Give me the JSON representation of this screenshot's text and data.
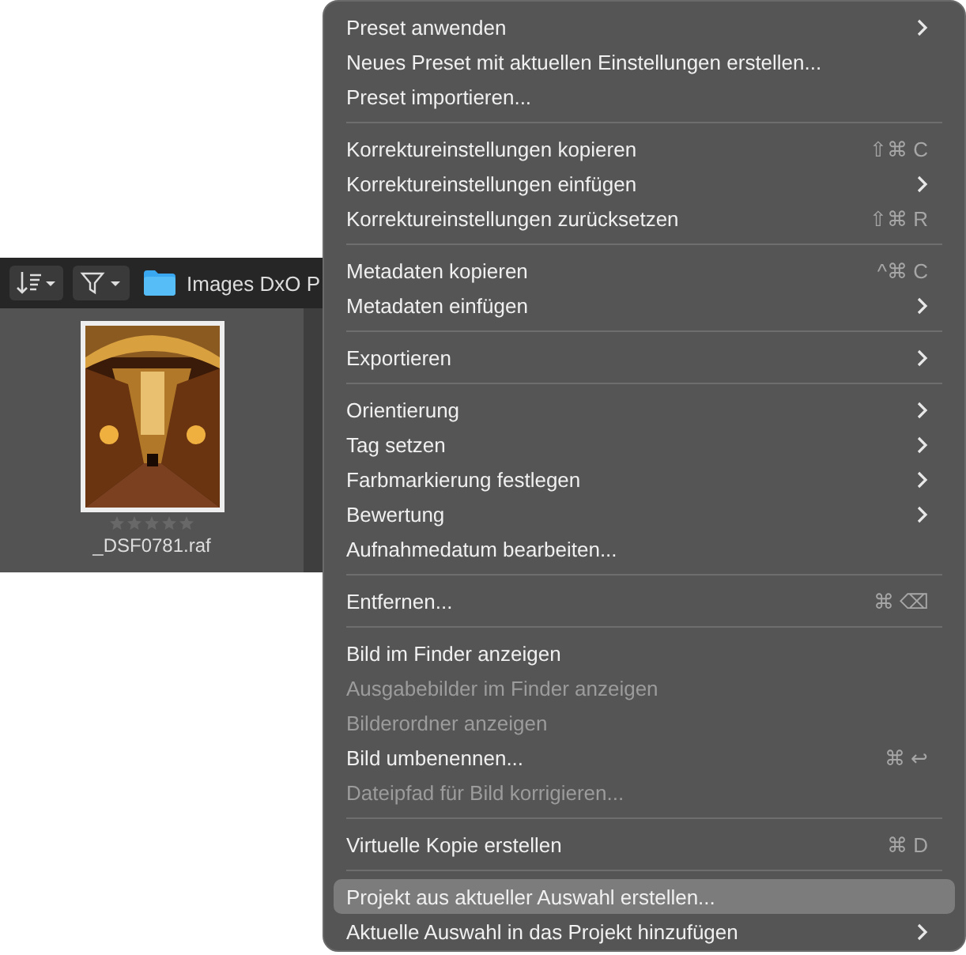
{
  "browser": {
    "folder": "Images DxO P",
    "thumbnail": {
      "kind": "picture",
      "stars": 0,
      "filename": "_DSF0781.raf"
    }
  },
  "menu": {
    "groups": [
      [
        {
          "label": "Preset anwenden",
          "submenu": true,
          "disabled": false,
          "selected": false
        },
        {
          "label": "Neues Preset mit aktuellen Einstellungen erstellen...",
          "submenu": false,
          "disabled": false,
          "selected": false
        },
        {
          "label": "Preset importieren...",
          "submenu": false,
          "disabled": false,
          "selected": false
        }
      ],
      [
        {
          "label": "Korrektureinstellungen kopieren",
          "shortcut": "⇧⌘ C",
          "submenu": false,
          "disabled": false,
          "selected": false
        },
        {
          "label": "Korrektureinstellungen einfügen",
          "submenu": true,
          "disabled": false,
          "selected": false
        },
        {
          "label": "Korrektureinstellungen zurücksetzen",
          "shortcut": "⇧⌘ R",
          "submenu": false,
          "disabled": false,
          "selected": false
        }
      ],
      [
        {
          "label": "Metadaten kopieren",
          "shortcut": "^⌘ C",
          "submenu": false,
          "disabled": false,
          "selected": false
        },
        {
          "label": "Metadaten einfügen",
          "submenu": true,
          "disabled": false,
          "selected": false
        }
      ],
      [
        {
          "label": "Exportieren",
          "submenu": true,
          "disabled": false,
          "selected": false
        }
      ],
      [
        {
          "label": "Orientierung",
          "submenu": true,
          "disabled": false,
          "selected": false
        },
        {
          "label": "Tag setzen",
          "submenu": true,
          "disabled": false,
          "selected": false
        },
        {
          "label": "Farbmarkierung festlegen",
          "submenu": true,
          "disabled": false,
          "selected": false
        },
        {
          "label": "Bewertung",
          "submenu": true,
          "disabled": false,
          "selected": false
        },
        {
          "label": "Aufnahmedatum bearbeiten...",
          "submenu": false,
          "disabled": false,
          "selected": false
        }
      ],
      [
        {
          "label": "Entfernen...",
          "shortcut": "⌘ ⌫",
          "submenu": false,
          "disabled": false,
          "selected": false
        }
      ],
      [
        {
          "label": "Bild im Finder anzeigen",
          "submenu": false,
          "disabled": false,
          "selected": false
        },
        {
          "label": "Ausgabebilder im Finder anzeigen",
          "submenu": false,
          "disabled": true,
          "selected": false
        },
        {
          "label": "Bilderordner anzeigen",
          "submenu": false,
          "disabled": true,
          "selected": false
        },
        {
          "label": "Bild umbenennen...",
          "shortcut": "⌘ ↩",
          "submenu": false,
          "disabled": false,
          "selected": false
        },
        {
          "label": "Dateipfad für Bild korrigieren...",
          "submenu": false,
          "disabled": true,
          "selected": false
        }
      ],
      [
        {
          "label": "Virtuelle Kopie erstellen",
          "shortcut": "⌘ D",
          "submenu": false,
          "disabled": false,
          "selected": false
        }
      ],
      [
        {
          "label": "Projekt aus aktueller Auswahl erstellen...",
          "submenu": false,
          "disabled": false,
          "selected": true
        },
        {
          "label": "Aktuelle Auswahl in das Projekt hinzufügen",
          "submenu": true,
          "disabled": false,
          "selected": false
        }
      ]
    ]
  }
}
